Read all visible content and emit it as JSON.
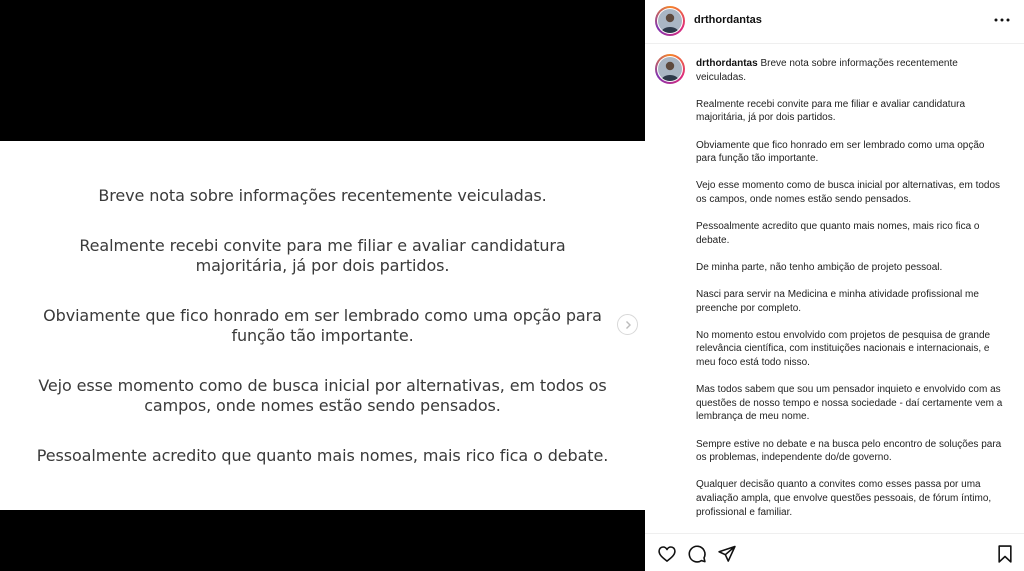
{
  "post": {
    "username": "drthordantas",
    "slide_paragraphs": [
      "Breve nota sobre informações recentemente veiculadas.",
      "Realmente recebi convite para me filiar e avaliar candidatura majoritária, já por dois partidos.",
      "Obviamente que fico honrado em ser lembrado como uma opção para função tão importante.",
      "Vejo esse momento como de busca inicial por alternativas, em todos os campos, onde nomes estão sendo pensados.",
      "Pessoalmente acredito que quanto mais nomes, mais rico fica o debate."
    ],
    "caption_first": "Breve nota sobre informações recentemente veiculadas.",
    "caption_paragraphs": [
      "Realmente recebi convite para me filiar e avaliar candidatura majoritária, já por dois partidos.",
      "Obviamente que fico honrado em ser lembrado como uma opção para função tão importante.",
      "Vejo esse momento como de busca inicial por alternativas, em todos os campos, onde nomes estão sendo pensados.",
      "Pessoalmente acredito que quanto mais nomes, mais rico fica o debate.",
      "De minha parte, não tenho ambição de projeto pessoal.",
      "Nasci para servir na Medicina e minha atividade profissional me preenche por completo.",
      "No momento estou envolvido com projetos de pesquisa de grande relevância científica, com instituições nacionais e internacionais, e meu foco está todo nisso.",
      "Mas todos sabem que sou um pensador inquieto e envolvido com as questões de nosso tempo e nossa sociedade - daí certamente vem a lembrança de meu nome.",
      "Sempre estive no debate e na busca pelo encontro de soluções para os problemas, independente do/de governo.",
      "Qualquer decisão quanto a convites como esses passa por uma avaliação ampla, que envolve questões pessoais, de fórum íntimo, profissional e familiar."
    ]
  },
  "icons": {
    "more": "more-options-icon",
    "next": "chevron-right-icon",
    "like": "heart-icon",
    "comment": "comment-icon",
    "share": "send-icon",
    "save": "bookmark-icon"
  }
}
